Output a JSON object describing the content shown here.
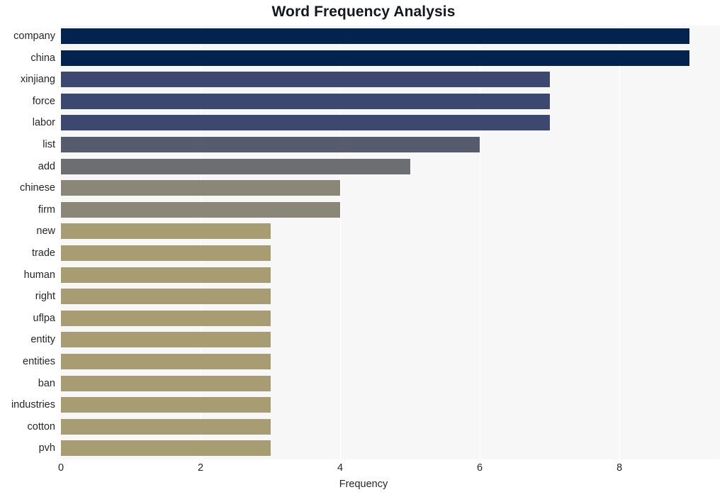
{
  "chart_data": {
    "type": "bar",
    "orientation": "horizontal",
    "title": "Word Frequency Analysis",
    "xlabel": "Frequency",
    "ylabel": "",
    "categories": [
      "company",
      "china",
      "xinjiang",
      "force",
      "labor",
      "list",
      "add",
      "chinese",
      "firm",
      "new",
      "trade",
      "human",
      "right",
      "uflpa",
      "entity",
      "entities",
      "ban",
      "industries",
      "cotton",
      "pvh"
    ],
    "values": [
      9,
      9,
      7,
      7,
      7,
      6,
      5,
      4,
      4,
      3,
      3,
      3,
      3,
      3,
      3,
      3,
      3,
      3,
      3,
      3
    ],
    "bar_colors": [
      "#02234d",
      "#02234d",
      "#3c4870",
      "#3c4870",
      "#3c4870",
      "#565c6e",
      "#6d6e71",
      "#8b8778",
      "#8b8778",
      "#a79c72",
      "#a79c72",
      "#a79c72",
      "#a79c72",
      "#a79c72",
      "#a79c72",
      "#a79c72",
      "#a79c72",
      "#a79c72",
      "#a79c72",
      "#a79c72"
    ],
    "xticks": [
      0,
      2,
      4,
      6,
      8
    ],
    "xtick_labels": [
      "0",
      "2",
      "4",
      "6",
      "8"
    ],
    "xlim": [
      0,
      9.44
    ],
    "grid": true,
    "grid_axis": "x",
    "legend": false,
    "plot_background": "#f7f7f7",
    "figure_background": "#ffffff",
    "gridline_color": "#ffffff",
    "text_color": "#262626",
    "title_color": "#14171c"
  }
}
